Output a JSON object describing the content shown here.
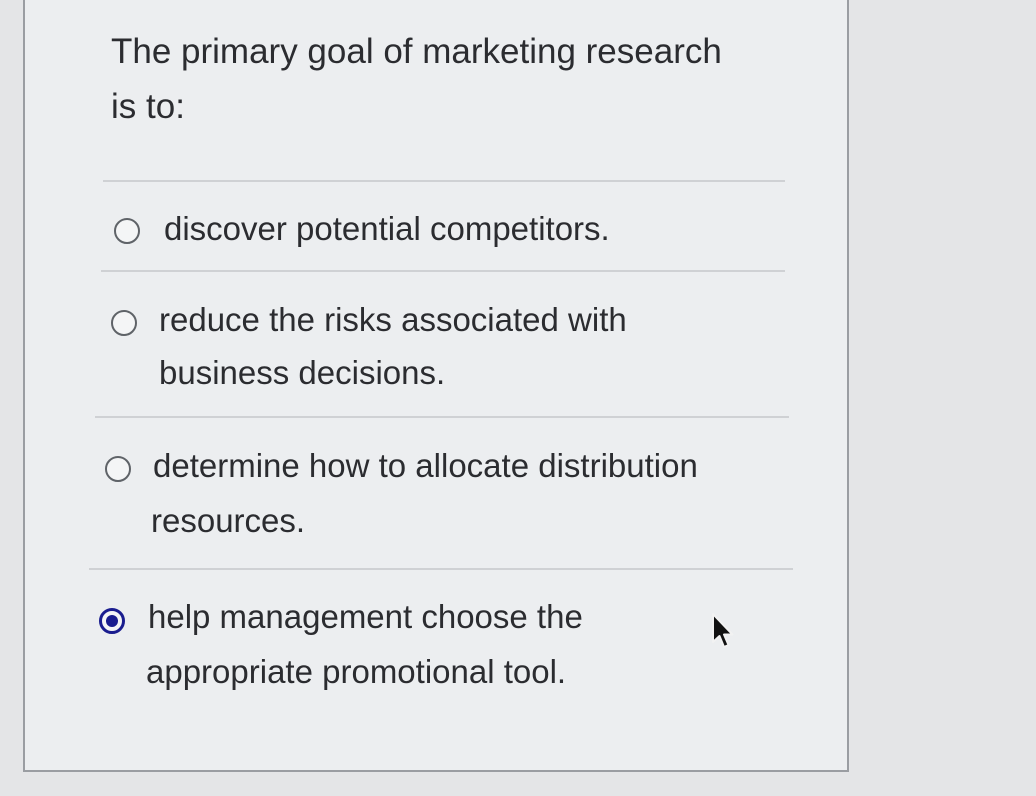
{
  "question": {
    "line1": "The primary goal of marketing research",
    "line2": "is to:"
  },
  "options": [
    {
      "line1": "discover potential competitors.",
      "line2": "",
      "selected": false
    },
    {
      "line1": "reduce the risks associated with",
      "line2": "business decisions.",
      "selected": false
    },
    {
      "line1": "determine how to allocate distribution",
      "line2": "resources.",
      "selected": false
    },
    {
      "line1": "help management choose the",
      "line2": "appropriate promotional tool.",
      "selected": true
    }
  ],
  "colors": {
    "selected_radio": "#1a1d8f"
  },
  "cursor_icon": "mouse-pointer-icon"
}
